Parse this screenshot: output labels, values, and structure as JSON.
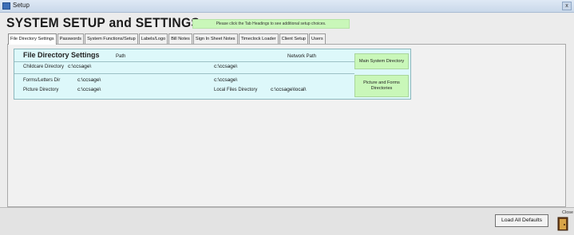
{
  "window": {
    "title": "Setup"
  },
  "header": {
    "title": "SYSTEM SETUP and SETTINGS",
    "hint": "Please click the Tab Headings to see additional setup choices."
  },
  "tabs": [
    "File Directory Settings",
    "Passwords",
    "System Functions/Setup",
    "Labels/Logo",
    "Bill Notes",
    "Sign In Sheet Notes",
    "Timeclock Loader",
    "Client Setup",
    "Users"
  ],
  "active_tab": "File Directory Settings",
  "file_dir": {
    "title": "File Directory Settings",
    "col_path": "Path",
    "col_network": "Network Path",
    "rows": [
      {
        "label": "Childcare Directory",
        "path": "c:\\ccsage\\",
        "network_label": "",
        "network": "c:\\ccsage\\"
      },
      {
        "label": "Forms/Letters Dir",
        "path": "c:\\ccsage\\",
        "network_label": "",
        "network": "c:\\ccsage\\"
      },
      {
        "label": "Picture Directory",
        "path": "c:\\ccsage\\",
        "network_label": "Local Files Directory",
        "network": "c:\\ccsage\\local\\"
      }
    ],
    "btn_main": "Main System Directory",
    "btn_pictures": "Picture and Forms Directories"
  },
  "footer": {
    "load_defaults": "Load All Defaults",
    "close_label": "Close"
  },
  "icons": {
    "close": "door-exit-icon",
    "app": "window-app-icon"
  }
}
